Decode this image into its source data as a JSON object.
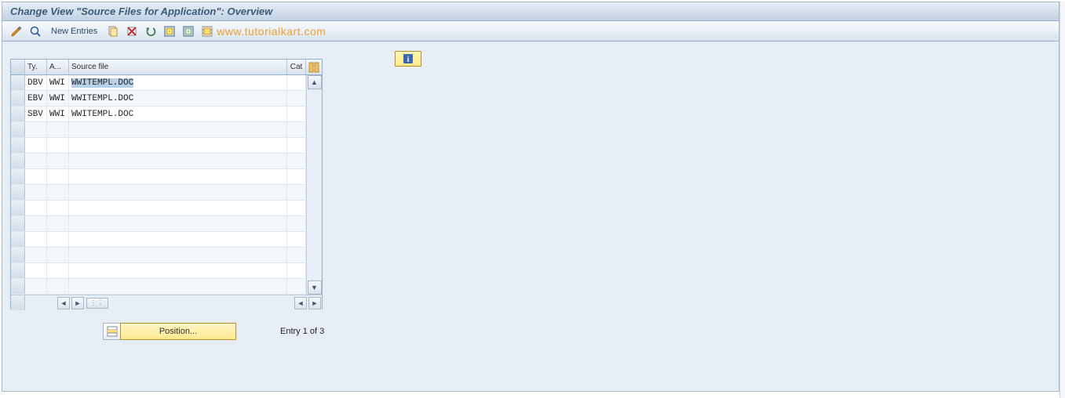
{
  "title": "Change View \"Source Files for Application\": Overview",
  "toolbar": {
    "new_entries_label": "New Entries"
  },
  "watermark": "www.tutorialkart.com",
  "grid": {
    "columns": {
      "ty": "Ty.",
      "a": "A...",
      "src": "Source file",
      "cat": "Cat"
    },
    "rows": [
      {
        "ty": "DBV",
        "a": "WWI",
        "src": "WWITEMPL.DOC",
        "selected": true
      },
      {
        "ty": "EBV",
        "a": "WWI",
        "src": "WWITEMPL.DOC",
        "selected": false
      },
      {
        "ty": "SBV",
        "a": "WWI",
        "src": "WWITEMPL.DOC",
        "selected": false
      }
    ]
  },
  "footer": {
    "position_label": "Position...",
    "entry_text": "Entry 1 of 3"
  }
}
